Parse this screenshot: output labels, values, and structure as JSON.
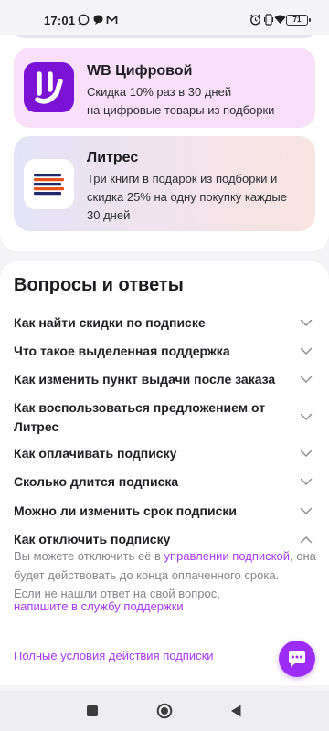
{
  "status_bar": {
    "time": "17:01",
    "battery": "71",
    "icons": [
      "whatsapp-icon",
      "chat-bubble-icon",
      "gmail-icon",
      "alarm-icon",
      "vibrate-icon",
      "signal-icon",
      "wifi-icon",
      "battery-icon"
    ]
  },
  "offers": [
    {
      "title": "WB Цифровой",
      "desc_line1": "Скидка 10% раз в 30 дней",
      "desc_line2": "на цифровые товары из подборки",
      "bg": "#f9dff8",
      "logo_color": "#7a13d6",
      "icon": "wb-digital-logo-icon"
    },
    {
      "title": "Литрес",
      "desc_line1": "Три книги в подарок из подборки и",
      "desc_line2": "скидка 25% на одну покупку каждые",
      "desc_line3": "30 дней",
      "icon": "litres-logo-icon"
    }
  ],
  "faq": {
    "title": "Вопросы и ответы",
    "items": [
      {
        "q_line1": "Как найти скидки по подписке",
        "expanded": false
      },
      {
        "q_line1": "Что такое выделенная поддержка",
        "expanded": false
      },
      {
        "q_line1": "Как изменить пункт выдачи после заказа",
        "expanded": false
      },
      {
        "q_line1": "Как воспользоваться предложением от",
        "q_line2": "Литрес",
        "expanded": false
      },
      {
        "q_line1": "Как оплачивать подписку",
        "expanded": false
      },
      {
        "q_line1": "Сколько длится подписка",
        "expanded": false
      },
      {
        "q_line1": "Можно ли изменить срок подписки",
        "expanded": false
      },
      {
        "q_line1": "Как отключить подписку",
        "expanded": true
      }
    ],
    "answer": {
      "pre": "Вы можете отключить её в ",
      "link": "управлении подпиской",
      "post": ", она будет действовать до конца оплаченного срока."
    },
    "help_text": "Если не нашли ответ на свой вопрос,",
    "support_link": "напишите в службу поддержки",
    "terms_link": "Полные условия действия подписки"
  },
  "colors": {
    "accent": "#a73afd",
    "fab": "#9b2df7",
    "text": "#1e1e24",
    "muted": "#86868e"
  },
  "nav": {
    "buttons": [
      "recent-apps-icon",
      "home-icon",
      "back-icon"
    ]
  }
}
